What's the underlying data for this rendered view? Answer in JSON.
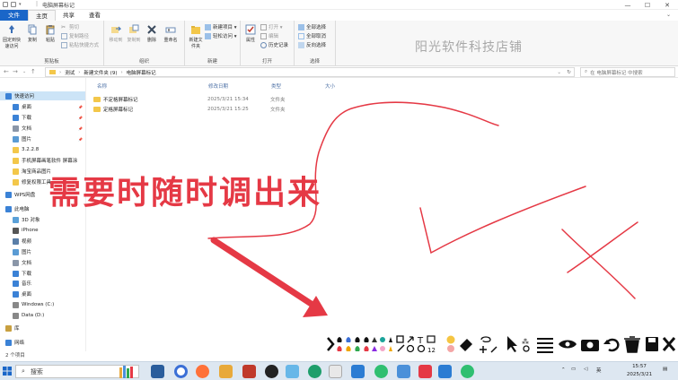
{
  "window": {
    "title": "电脑屏幕标记",
    "controls": [
      "—",
      "☐",
      "✕"
    ]
  },
  "ribbon_tabs": [
    "文件",
    "主页",
    "共享",
    "查看"
  ],
  "ribbon": {
    "clipboard": {
      "pin_label": "固定到快速访问",
      "copy_label": "复制",
      "paste_label": "粘贴",
      "cut_label": "剪切",
      "copy_path_label": "复制路径",
      "paste_shortcut_label": "粘贴快捷方式",
      "group_label": "剪贴板"
    },
    "organize": {
      "move_to_label": "移动到",
      "copy_to_label": "复制到",
      "delete_label": "删除",
      "rename_label": "重命名",
      "group_label": "组织"
    },
    "new": {
      "new_folder_label": "新建文件夹",
      "new_item_label": "新建项目 ▾",
      "easy_access_label": "轻松访问 ▾",
      "group_label": "新建"
    },
    "open": {
      "properties_label": "属性",
      "open_label": "打开 ▾",
      "edit_label": "编辑",
      "history_label": "历史记录",
      "group_label": "打开"
    },
    "select": {
      "select_all_label": "全部选择",
      "select_none_label": "全部取消",
      "invert_label": "反向选择",
      "group_label": "选择"
    }
  },
  "watermark": "阳光软件科技店铺",
  "address": {
    "breadcrumb": [
      "测试",
      "新建文件夹 (9)",
      "电脑屏幕标记"
    ],
    "search_placeholder": "在 电脑屏幕标记 中搜索"
  },
  "sidebar": {
    "items": [
      {
        "label": "快速访问",
        "icon": "star-icon",
        "selected": true
      },
      {
        "label": "桌面",
        "icon": "desktop-icon",
        "pinned": true
      },
      {
        "label": "下载",
        "icon": "download-icon",
        "pinned": true
      },
      {
        "label": "文档",
        "icon": "document-icon",
        "pinned": true
      },
      {
        "label": "图片",
        "icon": "picture-icon",
        "pinned": true
      },
      {
        "label": "3.2.2.8",
        "icon": "folder-icon"
      },
      {
        "label": "手机屏幕画笔软件 屏幕涂",
        "icon": "folder-icon"
      },
      {
        "label": "淘宝商品图片",
        "icon": "folder-icon"
      },
      {
        "label": "修复权限工具",
        "icon": "folder-icon"
      },
      {
        "label": "WPS网盘",
        "icon": "cloud-icon"
      },
      {
        "label": "此电脑",
        "icon": "computer-icon"
      },
      {
        "label": "3D 对象",
        "icon": "cube-icon"
      },
      {
        "label": "iPhone",
        "icon": "phone-icon"
      },
      {
        "label": "视频",
        "icon": "video-icon"
      },
      {
        "label": "图片",
        "icon": "picture-icon"
      },
      {
        "label": "文档",
        "icon": "document-icon"
      },
      {
        "label": "下载",
        "icon": "download-icon"
      },
      {
        "label": "音乐",
        "icon": "music-icon"
      },
      {
        "label": "桌面",
        "icon": "desktop-icon"
      },
      {
        "label": "Windows (C:)",
        "icon": "drive-icon"
      },
      {
        "label": "Data (D:)",
        "icon": "drive-icon"
      },
      {
        "label": "库",
        "icon": "library-icon"
      },
      {
        "label": "网络",
        "icon": "network-icon"
      }
    ]
  },
  "file_list": {
    "columns": [
      "名称",
      "修改日期",
      "类型",
      "大小"
    ],
    "rows": [
      {
        "name": "不定格屏幕标记",
        "date": "2025/3/21 15:34",
        "type": "文件夹",
        "size": ""
      },
      {
        "name": "定格屏幕标记",
        "date": "2025/3/21 15:25",
        "type": "文件夹",
        "size": ""
      }
    ]
  },
  "annotation": {
    "text": "需要时随时调出来",
    "color": "#e53945"
  },
  "status": {
    "count": "2 个项目"
  },
  "taskbar": {
    "search_label": "搜索",
    "time": "15:57",
    "date": "2025/3/21",
    "ime": "英"
  },
  "colors": {
    "accent": "#1a66c8",
    "annotation_red": "#e53945",
    "folder_yellow": "#f3c74a"
  }
}
